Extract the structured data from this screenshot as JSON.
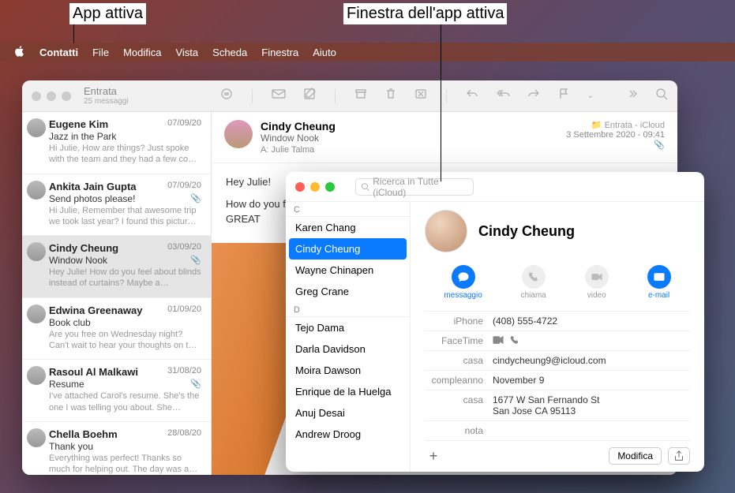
{
  "callouts": {
    "app_attiva": "App attiva",
    "finestra_attiva": "Finestra dell'app attiva"
  },
  "menubar": {
    "app": "Contatti",
    "file": "File",
    "modifica": "Modifica",
    "vista": "Vista",
    "scheda": "Scheda",
    "finestra": "Finestra",
    "aiuto": "Aiuto"
  },
  "mail": {
    "title": "Entrata",
    "subtitle": "25 messaggi",
    "header": {
      "sender": "Cindy Cheung",
      "subject": "Window Nook",
      "to_label": "A:",
      "to_value": "Julie Talma",
      "folder": "Entrata - iCloud",
      "datetime": "3 Settembre 2020 - 09:41"
    },
    "body_line1": "Hey Julie!",
    "body_line2": "How do you feel about blinds instead of curtains? Maybe a nice bright color. I think it would look GREAT",
    "messages": [
      {
        "sender": "Eugene Kim",
        "date": "07/09/20",
        "subject": "Jazz in the Park",
        "preview": "Hi Julie, How are things? Just spoke with the team and they had a few co…",
        "attach": false,
        "selected": false
      },
      {
        "sender": "Ankita Jain Gupta",
        "date": "07/09/20",
        "subject": "Send photos please!",
        "preview": "Hi Julie, Remember that awesome trip we took last year? I found this pictur…",
        "attach": true,
        "selected": false
      },
      {
        "sender": "Cindy Cheung",
        "date": "03/09/20",
        "subject": "Window Nook",
        "preview": "Hey Julie! How do you feel about blinds instead of curtains? Maybe a…",
        "attach": true,
        "selected": true
      },
      {
        "sender": "Edwina Greenaway",
        "date": "01/09/20",
        "subject": "Book club",
        "preview": "Are you free on Wednesday night? Can't wait to hear your thoughts on t…",
        "attach": false,
        "selected": false
      },
      {
        "sender": "Rasoul Al Malkawi",
        "date": "31/08/20",
        "subject": "Resume",
        "preview": "I've attached Carol's resume. She's the one I was telling you about. She…",
        "attach": true,
        "selected": false
      },
      {
        "sender": "Chella Boehm",
        "date": "28/08/20",
        "subject": "Thank you",
        "preview": "Everything was perfect! Thanks so much for helping out. The day was a…",
        "attach": false,
        "selected": false
      }
    ]
  },
  "contacts": {
    "search_placeholder": "Ricerca in Tutte (iCloud)",
    "groups": [
      {
        "letter": "C",
        "items": [
          "Karen Chang",
          "Cindy Cheung",
          "Wayne Chinapen",
          "Greg Crane"
        ]
      },
      {
        "letter": "D",
        "items": [
          "Tejo Dama",
          "Darla Davidson",
          "Moira Dawson",
          "Enrique de la Huelga",
          "Anuj Desai",
          "Andrew Droog"
        ]
      }
    ],
    "selected": "Cindy Cheung",
    "detail": {
      "name": "Cindy Cheung",
      "actions": {
        "message": "messaggio",
        "call": "chiama",
        "video": "video",
        "email": "e-mail"
      },
      "fields": {
        "iphone_label": "iPhone",
        "iphone_value": "(408) 555-4722",
        "facetime_label": "FaceTime",
        "home_label": "casa",
        "home_value": "cindycheung9@icloud.com",
        "birthday_label": "compleanno",
        "birthday_value": "November 9",
        "address_label": "casa",
        "address_line1": "1677 W San Fernando St",
        "address_line2": "San Jose CA 95113",
        "note_label": "nota"
      },
      "modify": "Modifica"
    }
  }
}
